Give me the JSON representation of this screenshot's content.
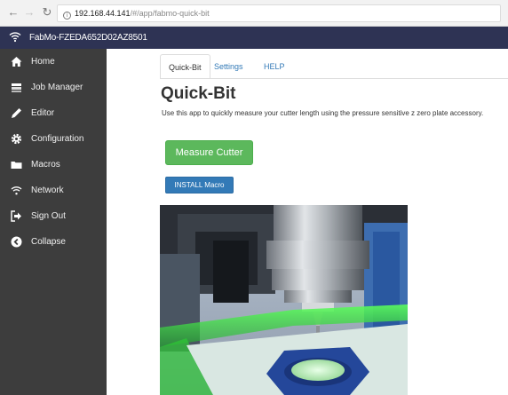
{
  "browser": {
    "url_host": "192.168.44.141",
    "url_path": "/#/app/fabmo-quick-bit"
  },
  "header": {
    "device_name": "FabMo-FZEDA652D02AZ8501"
  },
  "sidebar": {
    "items": [
      {
        "label": "Home",
        "icon": "home-icon"
      },
      {
        "label": "Job Manager",
        "icon": "job-manager-icon"
      },
      {
        "label": "Editor",
        "icon": "pencil-icon"
      },
      {
        "label": "Configuration",
        "icon": "gear-icon"
      },
      {
        "label": "Macros",
        "icon": "folder-icon"
      },
      {
        "label": "Network",
        "icon": "wifi-icon"
      },
      {
        "label": "Sign Out",
        "icon": "sign-out-icon"
      },
      {
        "label": "Collapse",
        "icon": "chevron-left-circle-icon"
      }
    ]
  },
  "tabs": [
    {
      "label": "Quick-Bit",
      "active": true
    },
    {
      "label": "Settings",
      "active": false
    },
    {
      "label": "HELP",
      "active": false
    }
  ],
  "main": {
    "title": "Quick-Bit",
    "description": "Use this app to quickly measure your cutter length using the pressure sensitive z zero plate accessory.",
    "measure_button": "Measure Cutter",
    "install_button": "INSTALL Macro"
  },
  "colors": {
    "header_bg": "#2e3354",
    "sidebar_bg": "#3d3d3d",
    "success": "#5cb85c",
    "primary": "#337ab7",
    "led_green": "#35e03a"
  }
}
